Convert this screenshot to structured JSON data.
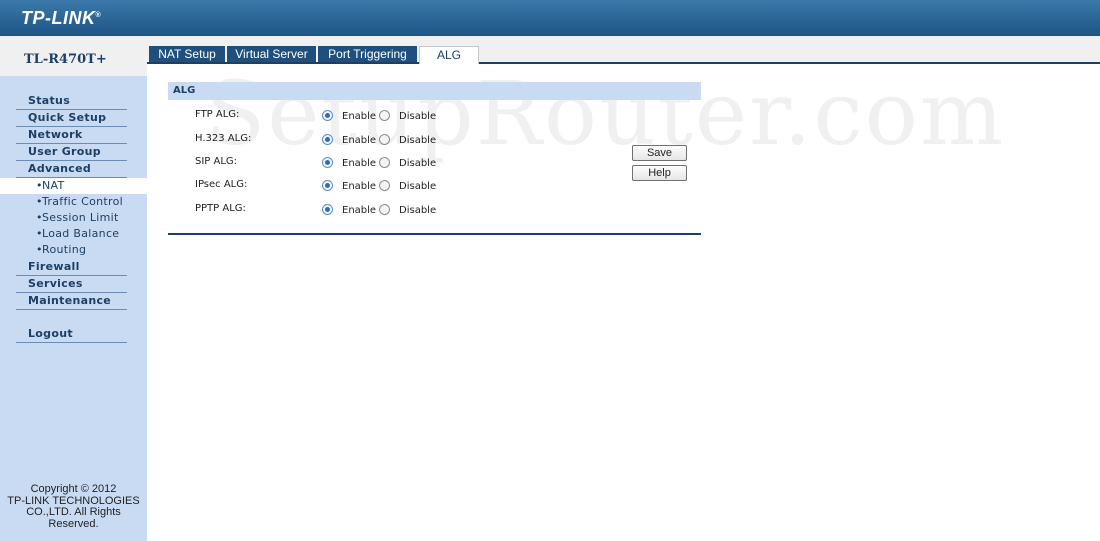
{
  "header": {
    "logo": "TP-LINK",
    "logo_mark": "®"
  },
  "sidebar": {
    "model": "TL-R470T+",
    "menu": [
      {
        "label": "Status",
        "type": "main"
      },
      {
        "label": "Quick Setup",
        "type": "main"
      },
      {
        "label": "Network",
        "type": "main"
      },
      {
        "label": "User Group",
        "type": "main"
      },
      {
        "label": "Advanced",
        "type": "main"
      },
      {
        "label": "NAT",
        "type": "sub",
        "active": true
      },
      {
        "label": "Traffic Control",
        "type": "sub"
      },
      {
        "label": "Session Limit",
        "type": "sub"
      },
      {
        "label": "Load Balance",
        "type": "sub"
      },
      {
        "label": "Routing",
        "type": "sub"
      },
      {
        "label": "Firewall",
        "type": "main"
      },
      {
        "label": "Services",
        "type": "main"
      },
      {
        "label": "Maintenance",
        "type": "main"
      },
      {
        "label": "Logout",
        "type": "main"
      }
    ],
    "copyright": {
      "line1": "Copyright © 2012",
      "line2": "TP-LINK TECHNOLOGIES",
      "line3": "CO.,LTD. All Rights",
      "line4": "Reserved."
    }
  },
  "tabs": [
    {
      "label": "NAT Setup",
      "active": false
    },
    {
      "label": "Virtual Server",
      "active": false
    },
    {
      "label": "Port Triggering",
      "active": false
    },
    {
      "label": "ALG",
      "active": true
    }
  ],
  "watermark": "SetupRouter.com",
  "panel": {
    "title": "ALG",
    "enable_label": "Enable",
    "disable_label": "Disable",
    "rows": [
      {
        "label": "FTP ALG:",
        "selected": "enable"
      },
      {
        "label": "H.323 ALG:",
        "selected": "enable"
      },
      {
        "label": "SIP ALG:",
        "selected": "enable"
      },
      {
        "label": "IPsec ALG:",
        "selected": "enable"
      },
      {
        "label": "PPTP ALG:",
        "selected": "enable"
      }
    ],
    "save_label": "Save",
    "help_label": "Help"
  },
  "colors": {
    "accent": "#1d3f66",
    "sidebar_bg": "#c9dbf3",
    "header": "#2a679a"
  }
}
